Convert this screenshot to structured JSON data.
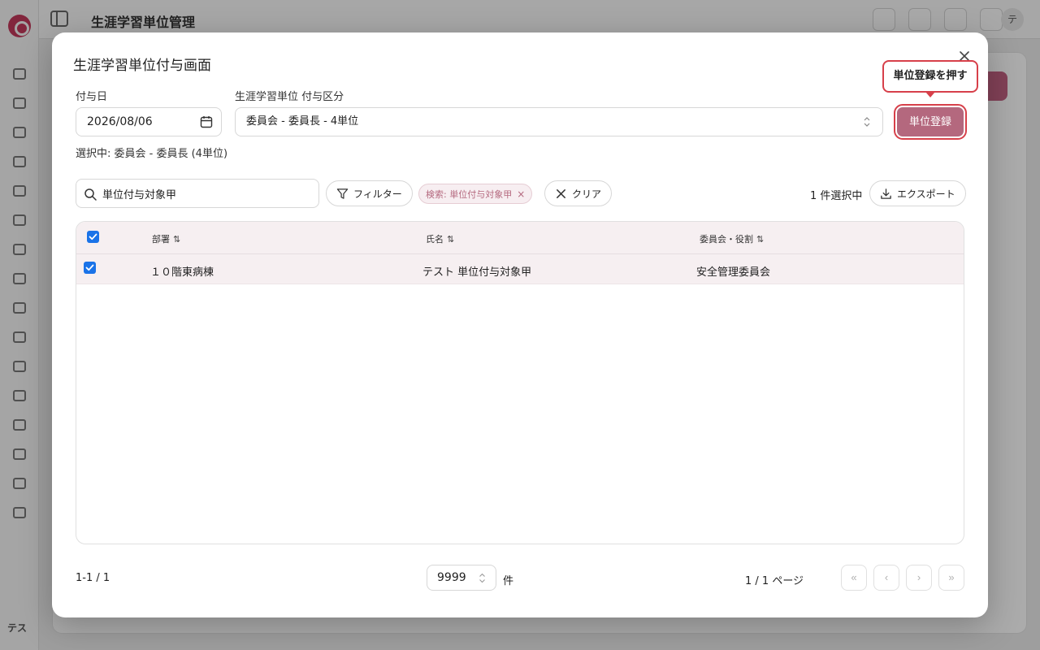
{
  "app": {
    "header_title": "生涯学習単位管理",
    "user_initials": "テ",
    "sidebar_user": "テス"
  },
  "modal": {
    "title": "生涯学習単位付与画面",
    "date_label": "付与日",
    "date_value": "2026/08/06",
    "category_label": "生涯学習単位 付与区分",
    "category_value": "委員会 - 委員長 - 4単位",
    "selected_note": "選択中: 委員会 - 委員長 (4単位)",
    "register_label": "単位登録",
    "callout": "単位登録を押す"
  },
  "toolbar": {
    "search_value": "単位付与対象甲",
    "filter_label": "フィルター",
    "chip_label": "検索: 単位付与対象甲",
    "chip_remove": "×",
    "clear_label": "クリア",
    "selection_count": "1 件選択中",
    "export_label": "エクスポート"
  },
  "table": {
    "headers": [
      "部署",
      "氏名",
      "委員会・役割"
    ],
    "sort_glyph": "⇅",
    "header_checked": true,
    "rows": [
      {
        "checked": true,
        "department": "１０階東病棟",
        "name": "テスト 単位付与対象甲",
        "committee": "安全管理委員会"
      }
    ]
  },
  "pagination": {
    "range": "1-1 / 1",
    "page_size": "9999",
    "unit": "件",
    "page_info": "1 / 1 ページ",
    "first": "«",
    "prev": "‹",
    "next": "›",
    "last": "»"
  },
  "colors": {
    "accent": "#b4687e",
    "callout_border": "#d7404a",
    "checkbox": "#1a73e8",
    "row_highlight": "#f6eff1"
  }
}
